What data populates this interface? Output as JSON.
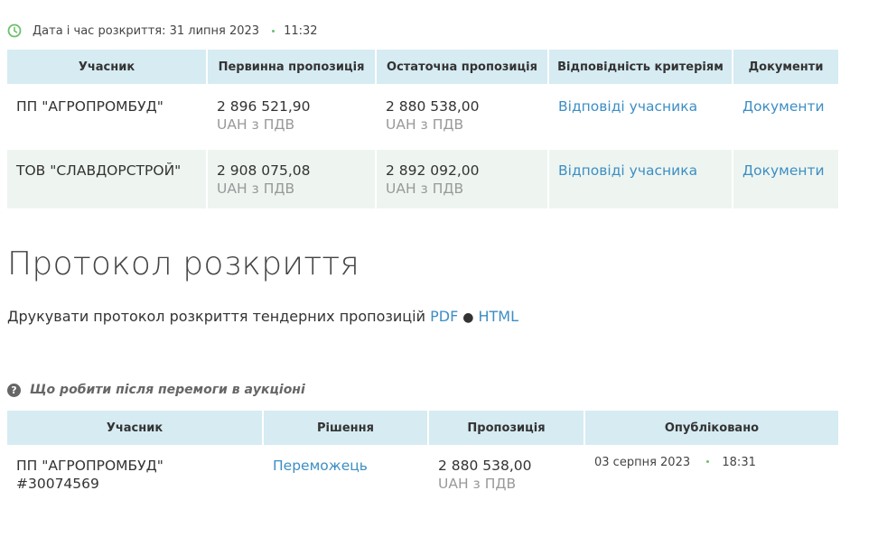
{
  "opened": {
    "label": "Дата і час розкриття: 31 липня 2023",
    "time": "11:32"
  },
  "bids_table": {
    "headers": [
      "Учасник",
      "Первинна пропозиція",
      "Остаточна пропозиція",
      "Відповідність критеріям",
      "Документи"
    ],
    "rows": [
      {
        "participant": "ПП \"АГРОПРОМБУД\"",
        "initial": "2 896 521,90",
        "initial_currency": "UAH з ПДВ",
        "final": "2 880 538,00",
        "final_currency": "UAH з ПДВ",
        "criteria_link": "Відповіді учасника",
        "docs_link": "Документи"
      },
      {
        "participant": "ТОВ \"СЛАВДОРСТРОЙ\"",
        "initial": "2 908 075,08",
        "initial_currency": "UAH з ПДВ",
        "final": "2 892 092,00",
        "final_currency": "UAH з ПДВ",
        "criteria_link": "Відповіді учасника",
        "docs_link": "Документи"
      }
    ]
  },
  "protocol": {
    "title": "Протокол розкриття",
    "print_text": "Друкувати протокол розкриття тендерних пропозицій",
    "pdf": "PDF",
    "separator": "●",
    "html": "HTML"
  },
  "help": {
    "icon": "question-icon",
    "text": "Що робити після перемоги в аукціоні"
  },
  "results_table": {
    "headers": [
      "Учасник",
      "Рішення",
      "Пропозиція",
      "Опубліковано"
    ],
    "rows": [
      {
        "participant": "ПП \"АГРОПРОМБУД\"",
        "participant_id": "#30074569",
        "decision": "Переможець",
        "amount": "2 880 538,00",
        "currency": "UAH з ПДВ",
        "published_date": "03 серпня 2023",
        "published_time": "18:31"
      }
    ]
  },
  "colors": {
    "header_bg": "#d6ebf2",
    "row_alt_bg": "#eef5f0",
    "link": "#3d8ec4",
    "muted": "#999999",
    "clock": "#6cbf6c"
  }
}
